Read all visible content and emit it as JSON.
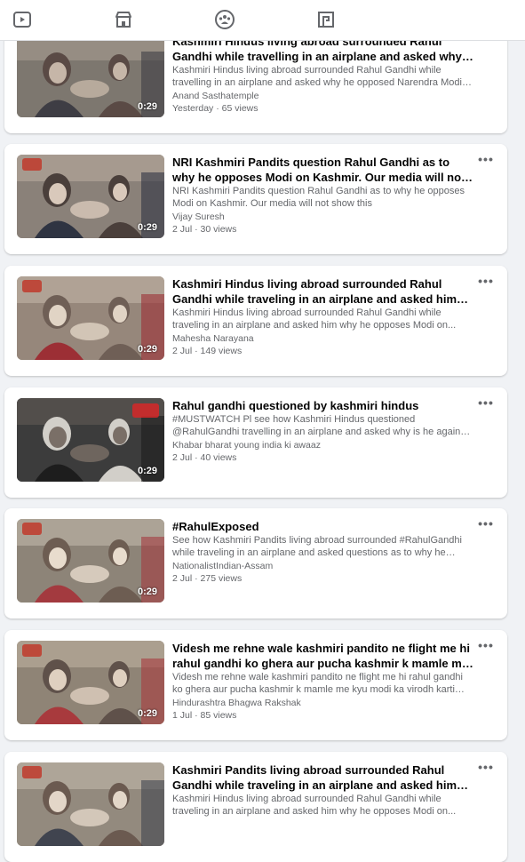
{
  "nav": {
    "icons": [
      "video-icon",
      "marketplace-icon",
      "groups-icon",
      "gaming-icon"
    ]
  },
  "videos": [
    {
      "title": "Kashmiri Hindus living abroad surrounded Rahul Gandhi while travelling in an airplane and asked why he opposed...",
      "description": "Kashmiri Hindus living abroad surrounded Rahul Gandhi while travelling in an airplane and asked why he opposed Narendra Modi o...",
      "author": "Anand Sasthatemple",
      "meta": "Yesterday · 65 views",
      "duration": "0:29"
    },
    {
      "title": "NRI Kashmiri Pandits question Rahul Gandhi as to why he opposes Modi on Kashmir. Our media will not show this",
      "description": "NRI Kashmiri Pandits question Rahul Gandhi as to why he opposes Modi on Kashmir. Our media will not show this",
      "author": "Vijay Suresh",
      "meta": "2 Jul · 30 views",
      "duration": "0:29"
    },
    {
      "title": "Kashmiri Hindus living abroad surrounded Rahul Gandhi while traveling in an airplane and asked him why he...",
      "description": "Kashmiri Hindus living abroad surrounded Rahul Gandhi while traveling in an airplane and asked him why he opposes Modi on...",
      "author": "Mahesha Narayana",
      "meta": "2 Jul · 149 views",
      "duration": "0:29"
    },
    {
      "title": "Rahul gandhi questioned by kashmiri hindus",
      "description": "#MUSTWATCH Pl see how Kashmiri Hindus questioned @RahulGandhi travelling in an airplane and asked why is he against them? FYI: Rahul...",
      "author": "Khabar bharat young india ki awaaz",
      "meta": "2 Jul · 40 views",
      "duration": "0:29"
    },
    {
      "title": "#RahulExposed",
      "description": "See how Kashmiri Pandits living abroad surrounded #RahulGandhi while traveling in an airplane and asked questions as to why he oppo...",
      "author": "NationalistIndian-Assam",
      "meta": "2 Jul · 275 views",
      "duration": "0:29"
    },
    {
      "title": "Videsh me rehne wale kashmiri pandito ne flight me hi rahul gandhi ko ghera aur pucha kashmir k mamle me ky...",
      "description": "Videsh me rehne wale kashmiri pandito ne flight me hi rahul gandhi ko ghera aur pucha kashmir k mamle me kyu modi ka virodh karti he...",
      "author": "Hindurashtra Bhagwa Rakshak",
      "meta": "1 Jul · 85 views",
      "duration": "0:29"
    },
    {
      "title": "Kashmiri Pandits living abroad surrounded Rahul Gandhi while traveling in an airplane and asked him why he...",
      "description": "Kashmiri Hindus living abroad surrounded Rahul Gandhi while traveling in an airplane and asked him why he opposes Modi on...",
      "author": "",
      "meta": "",
      "duration": ""
    }
  ]
}
